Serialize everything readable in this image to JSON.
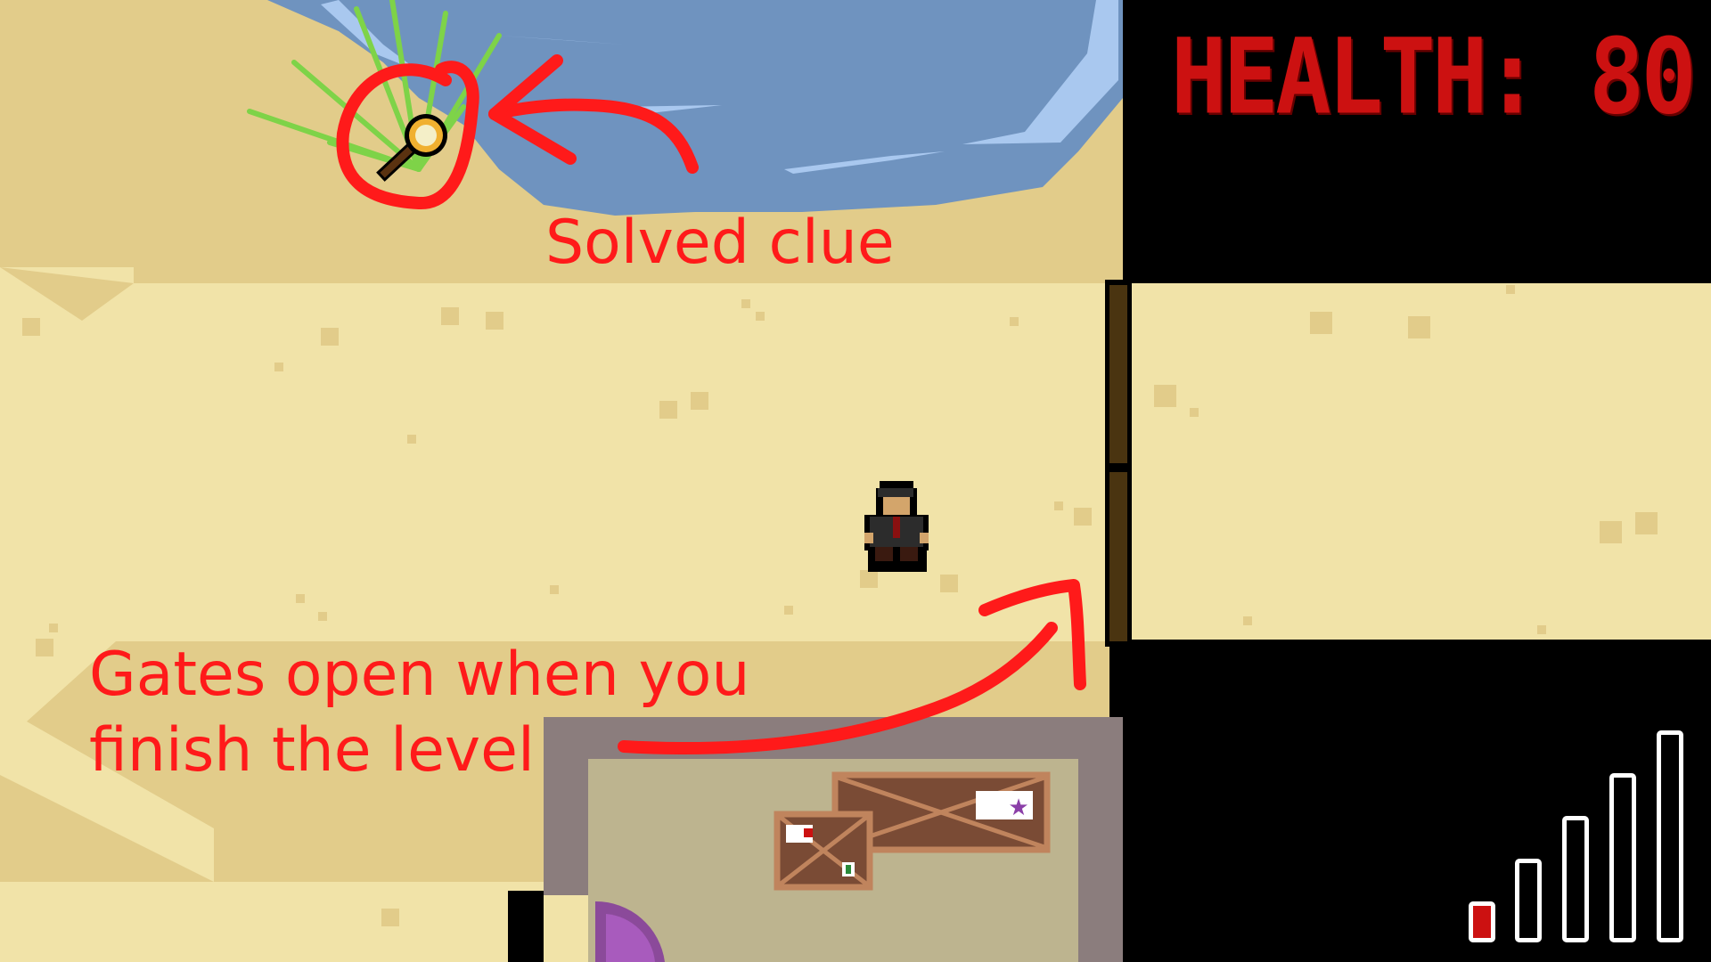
{
  "hud": {
    "health_label": "HEALTH:",
    "health_value": "80",
    "health_display": "HEALTH: 80",
    "health_color": "#cc1111"
  },
  "annotations": {
    "clue_text": "Solved clue",
    "gates_line1": "Gates open when you",
    "gates_line2": "finish the level",
    "color": "#ff1a1a"
  },
  "signal": {
    "bars_total": 5,
    "bars_active": 1,
    "active_color": "#cc1111"
  },
  "colors": {
    "sand": "#f1e3a8",
    "dark_sand": "#e2cc8a",
    "water": "#6f93bf",
    "gate": "#4a3410",
    "building_wall": "#8b7d7d",
    "building_floor": "#bdb48f",
    "crate": "#7a4b35"
  },
  "icons": [
    "magnifying-glass-icon",
    "player-character",
    "star-icon",
    "arrow-icon"
  ]
}
